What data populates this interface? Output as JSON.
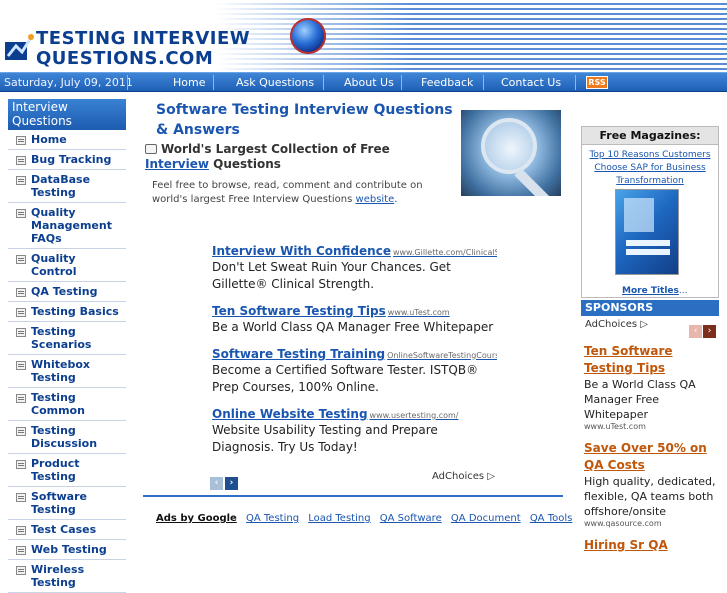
{
  "header": {
    "logo_line1": "TESTING INTERVIEW",
    "logo_line2": "QUESTIONS.COM"
  },
  "navbar": {
    "date": "Saturday, July 09, 2011",
    "items": [
      "Home",
      "Ask Questions",
      "About Us",
      "Feedback",
      "Contact Us"
    ],
    "rss": "RSS"
  },
  "sidebar": {
    "title": "Interview Questions",
    "items": [
      "Home",
      "Bug Tracking",
      "DataBase Testing",
      "Quality Management FAQs",
      "Quality Control",
      "QA Testing",
      "Testing Basics",
      "Testing Scenarios",
      "Whitebox Testing",
      "Testing Common",
      "Testing Discussion",
      "Product Testing",
      "Software Testing",
      "Test Cases",
      "Web Testing",
      "Wireless Testing"
    ]
  },
  "main": {
    "title": "Software Testing Interview Questions & Answers",
    "tagline_prefix": "World's Largest Collection of Free ",
    "tagline_link": "Interview",
    "tagline_suffix": " Questions",
    "intro_text": "Feel free to browse, read, comment and contribute on world's largest Free Interview Questions ",
    "intro_link": "website",
    "intro_end": "."
  },
  "ads": [
    {
      "title": "Interview With Confidence",
      "url": "www.Gillette.com/ClinicalStreng",
      "desc": "Don't Let Sweat Ruin Your Chances. Get Gillette® Clinical Strength."
    },
    {
      "title": "Ten Software Testing Tips",
      "url": "www.uTest.com",
      "desc": "Be a World Class QA Manager Free Whitepaper"
    },
    {
      "title": "Software Testing Training",
      "url": "OnlineSoftwareTestingCourses.c",
      "desc": "Become a Certified Software Tester. ISTQB® Prep Courses, 100% Online."
    },
    {
      "title": "Online Website Testing",
      "url": "www.usertesting.com/",
      "desc": "Website Usability Testing and Prepare Diagnosis. Try Us Today!"
    }
  ],
  "adchoices": "AdChoices",
  "pager": {
    "prev": "‹",
    "next": "›"
  },
  "adlinks": {
    "label": "Ads by Google",
    "links": [
      "QA Testing",
      "Load Testing",
      "QA Software",
      "QA Document",
      "QA Tools"
    ]
  },
  "magazines": {
    "title": "Free Magazines:",
    "link": "Top 10 Reasons Customers Choose SAP for Business Transformation",
    "more": "More Titles",
    "more_suffix": "..."
  },
  "sponsors": {
    "title": "SPONSORS",
    "adchoices": "AdChoices",
    "ads": [
      {
        "title": "Ten Software Testing Tips",
        "desc": "Be a World Class QA Manager Free Whitepaper",
        "url": "www.uTest.com"
      },
      {
        "title": "Save Over 50% on QA Costs",
        "desc": "High quality, dedicated, flexible, QA teams both offshore/onsite",
        "url": "www.qasource.com"
      },
      {
        "title": "Hiring Sr QA",
        "desc": "",
        "url": ""
      }
    ]
  },
  "colors": {
    "accent": "#1a56b0",
    "nav": "#2a6fc2",
    "sponsor_link": "#c0570a"
  }
}
